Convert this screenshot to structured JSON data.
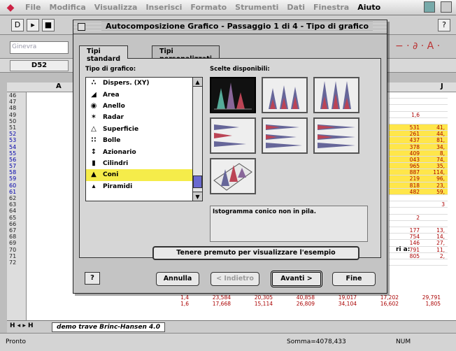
{
  "menubar": {
    "apple": "◆",
    "items": [
      "File",
      "Modifica",
      "Visualizza",
      "Inserisci",
      "Formato",
      "Strumenti",
      "Dati",
      "Finestra",
      "Aiuto"
    ]
  },
  "toolbar": {
    "new": "D",
    "open": "▸",
    "save": "■",
    "help": "?"
  },
  "format_bar": {
    "font_value": "Ginevra",
    "tools": "− · ∂ · A ·"
  },
  "name_box": "D52",
  "sheet": {
    "col_a": "A",
    "col_j": "J",
    "rows": [
      "46",
      "47",
      "48",
      "49",
      "50",
      "51",
      "52",
      "53",
      "54",
      "55",
      "56",
      "57",
      "58",
      "59",
      "60",
      "61",
      "62",
      "63",
      "64",
      "65",
      "66",
      "67",
      "68",
      "69",
      "70",
      "71",
      "72"
    ],
    "right_cells": [
      "",
      "",
      "",
      "1,6",
      "",
      "531",
      "261",
      "437",
      "378",
      "409",
      "043",
      "965",
      "887",
      "219",
      "818",
      "482",
      "",
      "",
      "",
      "2",
      "",
      "177",
      "754",
      "146",
      "791",
      "805",
      ""
    ],
    "right_values_j": [
      "",
      "",
      "",
      "",
      "",
      "41,",
      "44,",
      "81,",
      "34,",
      "8,",
      "74,",
      "35,",
      "114,",
      "96,",
      "23,",
      "59,",
      "",
      "3",
      "",
      "",
      "",
      "13,",
      "14,",
      "27,",
      "11,",
      "2,",
      ""
    ],
    "label_ria": "ri a:",
    "bottom_rows": [
      [
        "1,4",
        "23,584",
        "20,305",
        "40,858",
        "19,017",
        "17,202",
        "29,791"
      ],
      [
        "1,6",
        "17,668",
        "15,114",
        "26,809",
        "34,104",
        "16,602",
        "1,805"
      ]
    ]
  },
  "sheet_tab": "demo trave Brinc-Hansen 4.0",
  "status": {
    "left": "Pronto",
    "sum": "Somma=4078,433",
    "num": "NUM"
  },
  "dialog": {
    "title": "Autocomposizione Grafico - Passaggio 1 di 4 - Tipo di grafico",
    "tabs": [
      "Tipi standard",
      "Tipi personalizzati"
    ],
    "type_label": "Tipo di grafico:",
    "choices_label": "Scelte disponibili:",
    "types": [
      {
        "label": "Dispers. (XY)",
        "icon": "scatter-icon"
      },
      {
        "label": "Area",
        "icon": "area-icon"
      },
      {
        "label": "Anello",
        "icon": "doughnut-icon"
      },
      {
        "label": "Radar",
        "icon": "radar-icon"
      },
      {
        "label": "Superficie",
        "icon": "surface-icon"
      },
      {
        "label": "Bolle",
        "icon": "bubble-icon"
      },
      {
        "label": "Azionario",
        "icon": "stock-icon"
      },
      {
        "label": "Cilindri",
        "icon": "cylinder-icon"
      },
      {
        "label": "Coni",
        "icon": "cone-icon"
      },
      {
        "label": "Piramidi",
        "icon": "pyramid-icon"
      }
    ],
    "selected_type": "Coni",
    "description": "Istogramma conico non in pila.",
    "preview_button": "Tenere premuto per visualizzare l'esempio",
    "help_button": "?",
    "buttons": {
      "cancel": "Annulla",
      "back": "< Indietro",
      "next": "Avanti >",
      "finish": "Fine"
    }
  }
}
